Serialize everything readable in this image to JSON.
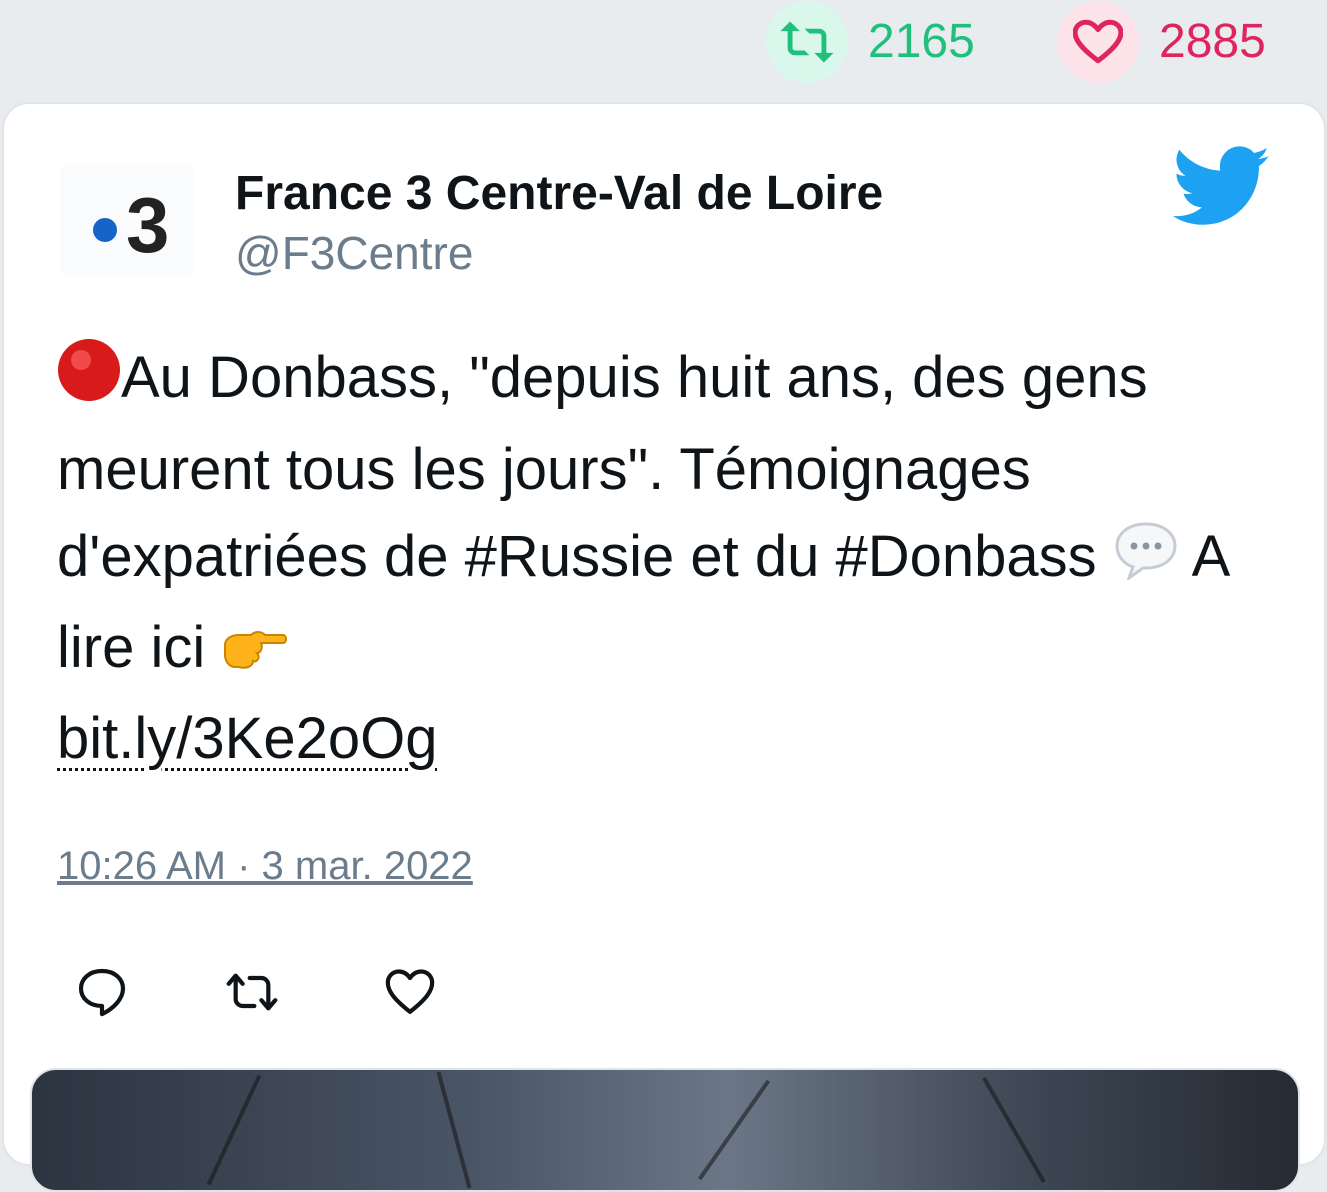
{
  "stats": {
    "retweets": "2165",
    "likes": "2885",
    "retweet_color": "#1fbf7c",
    "like_color": "#e0245e"
  },
  "tweet": {
    "author_name": "France 3 Centre-Val de Loire",
    "author_handle": "@F3Centre",
    "avatar_logo_text": "3",
    "text_line1": "Au Donbass, \"depuis huit ans, des gens meurent tous les jours\". Témoignages d'expatriées de #Russie et du #Donbass",
    "text_line2": "A lire ici",
    "link": "bit.ly/3Ke2oOg",
    "timestamp": "10:26 AM · 3 mar. 2022"
  },
  "icons": {
    "retweet": "retweet-icon",
    "like": "heart-icon",
    "reply": "reply-icon",
    "brand": "twitter-bird-icon",
    "emoji_red_circle": "🔴",
    "emoji_speech": "💬",
    "emoji_pointing": "👉"
  }
}
